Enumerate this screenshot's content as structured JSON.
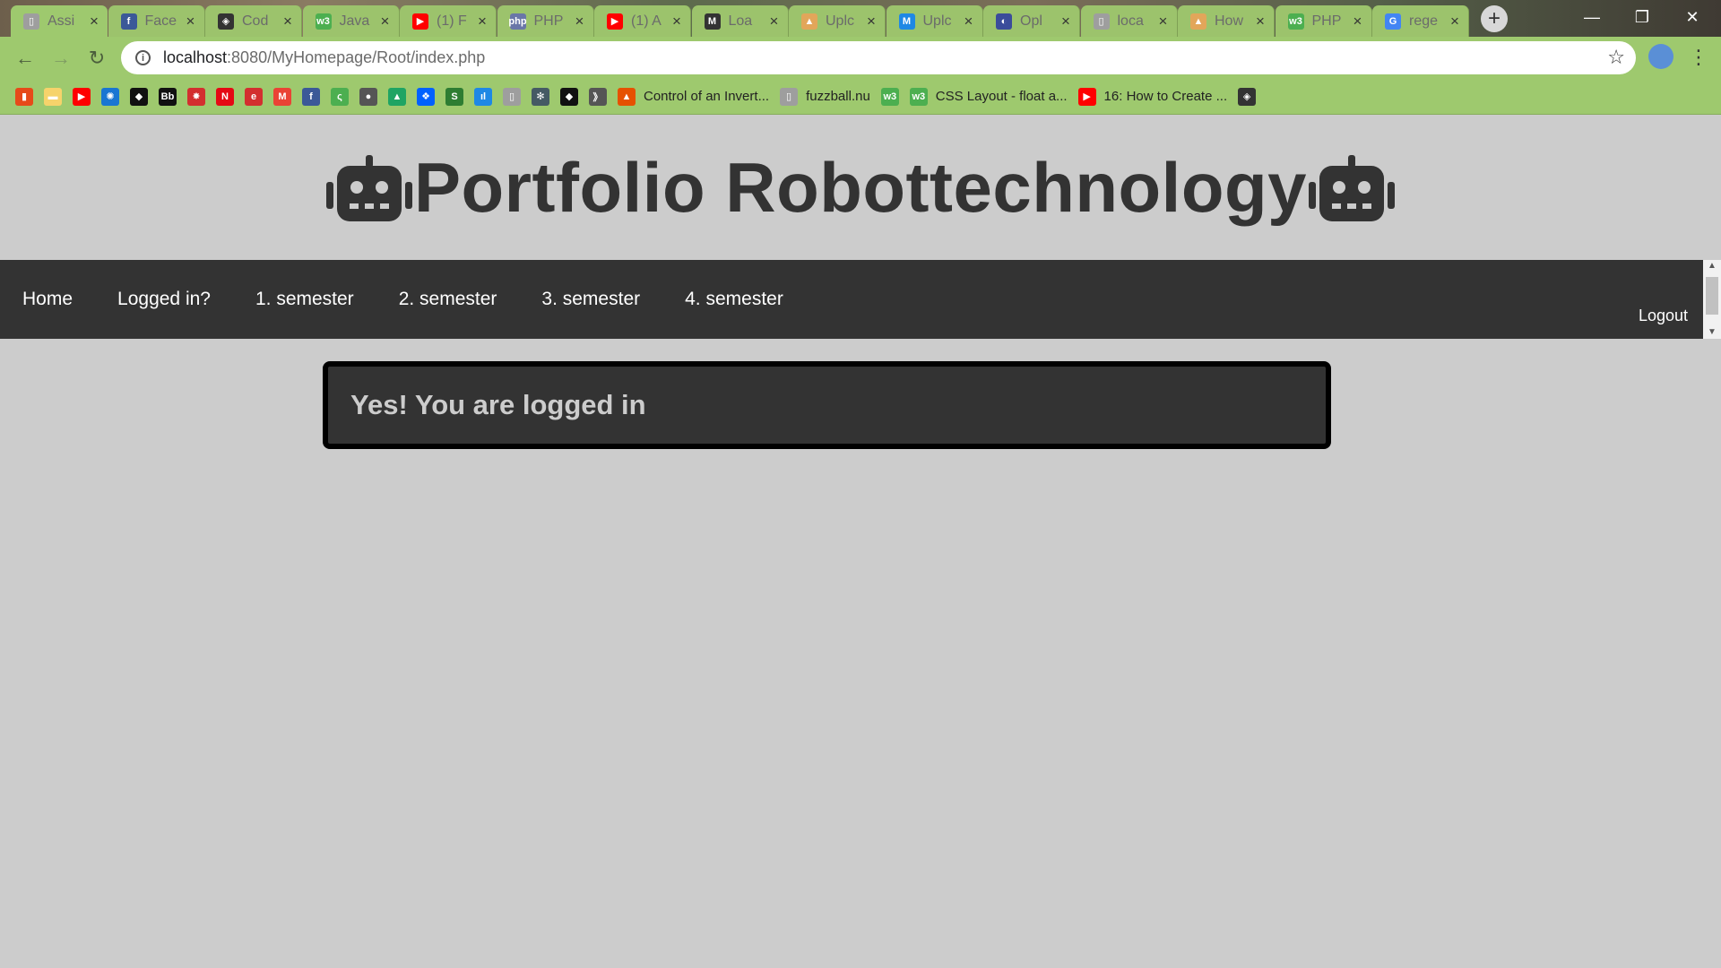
{
  "browser": {
    "tabs": [
      {
        "title": "Assi",
        "icon": "doc-icon",
        "color": "#9e9e9e",
        "glyph": "▯"
      },
      {
        "title": "Face",
        "icon": "facebook-icon",
        "color": "#3b5998",
        "glyph": "f"
      },
      {
        "title": "Cod",
        "icon": "codepen-icon",
        "color": "#333333",
        "glyph": "◈"
      },
      {
        "title": "Java",
        "icon": "w3schools-icon",
        "color": "#4caf50",
        "glyph": "w3"
      },
      {
        "title": "(1) F",
        "icon": "youtube-icon",
        "color": "#ff0000",
        "glyph": "▶"
      },
      {
        "title": "PHP",
        "icon": "php-icon",
        "color": "#6a76a8",
        "glyph": "php"
      },
      {
        "title": "(1) A",
        "icon": "youtube-icon",
        "color": "#ff0000",
        "glyph": "▶"
      },
      {
        "title": "Loa",
        "icon": "m-bracket-icon",
        "color": "#333333",
        "glyph": "M"
      },
      {
        "title": "Uplc",
        "icon": "flame-icon",
        "color": "#e2a65a",
        "glyph": "▲"
      },
      {
        "title": "Uplc",
        "icon": "m-icon",
        "color": "#1e88e5",
        "glyph": "M"
      },
      {
        "title": "Opl",
        "icon": "moon-icon",
        "color": "#3b4c9b",
        "glyph": "◐"
      },
      {
        "title": "loca",
        "icon": "doc-icon",
        "color": "#9e9e9e",
        "glyph": "▯"
      },
      {
        "title": "How",
        "icon": "flame-icon",
        "color": "#e2a65a",
        "glyph": "▲"
      },
      {
        "title": "PHP",
        "icon": "w3schools-icon",
        "color": "#4caf50",
        "glyph": "w3"
      },
      {
        "title": "rege",
        "icon": "google-icon",
        "color": "#4285f4",
        "glyph": "G"
      }
    ],
    "url_host": "localhost",
    "url_rest": ":8080/MyHomepage/Root/index.php",
    "bookmarks": [
      {
        "label": "",
        "icon": "office-icon",
        "color": "#e64a19",
        "glyph": "▮"
      },
      {
        "label": "",
        "icon": "folder-icon",
        "color": "#f6d36b",
        "glyph": "▬"
      },
      {
        "label": "",
        "icon": "youtube-icon",
        "color": "#ff0000",
        "glyph": "▶"
      },
      {
        "label": "",
        "icon": "steam-icon",
        "color": "#1976d2",
        "glyph": "✺"
      },
      {
        "label": "",
        "icon": "black-app-icon",
        "color": "#111111",
        "glyph": "◆"
      },
      {
        "label": "",
        "icon": "bb-icon",
        "color": "#111111",
        "glyph": "Bb"
      },
      {
        "label": "",
        "icon": "red-star-icon",
        "color": "#d32f2f",
        "glyph": "✸"
      },
      {
        "label": "",
        "icon": "netflix-icon",
        "color": "#e50914",
        "glyph": "N"
      },
      {
        "label": "",
        "icon": "e-icon",
        "color": "#d32f2f",
        "glyph": "e"
      },
      {
        "label": "",
        "icon": "gmail-icon",
        "color": "#ea4335",
        "glyph": "M"
      },
      {
        "label": "",
        "icon": "facebook-icon",
        "color": "#3b5998",
        "glyph": "f"
      },
      {
        "label": "",
        "icon": "green-swirl-icon",
        "color": "#4caf50",
        "glyph": "ς"
      },
      {
        "label": "",
        "icon": "apple-icon",
        "color": "#555555",
        "glyph": "●"
      },
      {
        "label": "",
        "icon": "drive-icon",
        "color": "#1fa463",
        "glyph": "▲"
      },
      {
        "label": "",
        "icon": "dropbox-icon",
        "color": "#0061ff",
        "glyph": "❖"
      },
      {
        "label": "",
        "icon": "s-app-icon",
        "color": "#2e7d32",
        "glyph": "S"
      },
      {
        "label": "",
        "icon": "blue-chart-icon",
        "color": "#1e88e5",
        "glyph": "ıl"
      },
      {
        "label": "",
        "icon": "doc-icon",
        "color": "#9e9e9e",
        "glyph": "▯"
      },
      {
        "label": "",
        "icon": "gear-grid-icon",
        "color": "#455a64",
        "glyph": "✻"
      },
      {
        "label": "",
        "icon": "black-app-icon",
        "color": "#111111",
        "glyph": "◆"
      },
      {
        "label": "",
        "icon": "wave-icon",
        "color": "#555555",
        "glyph": "》"
      },
      {
        "label": "Control of an Invert...",
        "icon": "matlab-icon",
        "color": "#e65100",
        "glyph": "▲"
      },
      {
        "label": "fuzzball.nu",
        "icon": "doc-icon",
        "color": "#9e9e9e",
        "glyph": "▯"
      },
      {
        "label": "",
        "icon": "w3schools-icon",
        "color": "#4caf50",
        "glyph": "w3"
      },
      {
        "label": "CSS Layout - float a...",
        "icon": "w3schools-icon",
        "color": "#4caf50",
        "glyph": "w3"
      },
      {
        "label": "16: How to Create ...",
        "icon": "youtube-icon",
        "color": "#ff0000",
        "glyph": "▶"
      },
      {
        "label": "",
        "icon": "codepen-icon",
        "color": "#333333",
        "glyph": "◈"
      }
    ]
  },
  "site": {
    "title": "Portfolio Robottechnology",
    "nav": [
      "Home",
      "Logged in?",
      "1. semester",
      "2. semester",
      "3. semester",
      "4. semester"
    ],
    "logout": "Logout",
    "message": "Yes! You are logged in"
  }
}
